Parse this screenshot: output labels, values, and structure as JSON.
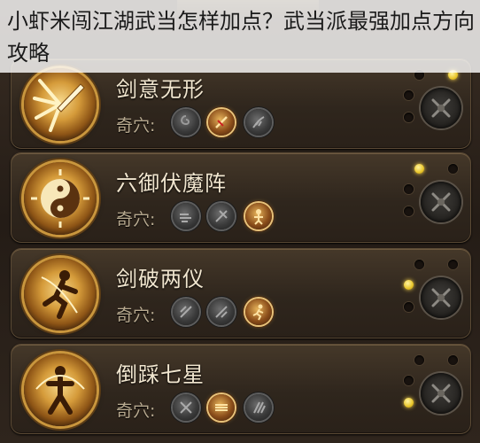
{
  "caption": "小虾米闯江湖武当怎样加点？武当派最强加点方向攻略",
  "skills": [
    {
      "name": "剑意无形",
      "qixue_label": "奇穴:",
      "active_slot": 2,
      "lit_dots": [
        "tr"
      ]
    },
    {
      "name": "六御伏魔阵",
      "qixue_label": "奇穴:",
      "active_slot": 3,
      "lit_dots": [
        "tl"
      ]
    },
    {
      "name": "剑破两仪",
      "qixue_label": "奇穴:",
      "active_slot": 3,
      "lit_dots": [
        "ml"
      ]
    },
    {
      "name": "倒踩七星",
      "qixue_label": "奇穴:",
      "active_slot": 2,
      "lit_dots": [
        "bl"
      ]
    }
  ],
  "icons": {
    "skill_1": "sword-rays-icon",
    "skill_2": "yin-yang-icon",
    "skill_3": "running-figure-icon",
    "skill_4": "warrior-figure-icon",
    "emblem": "crossed-swords-icon"
  },
  "colors": {
    "gold": "#e8c52a",
    "name_text": "#f1e6cf",
    "label_text": "#b7a98f",
    "card_border": "#5b4a35"
  }
}
